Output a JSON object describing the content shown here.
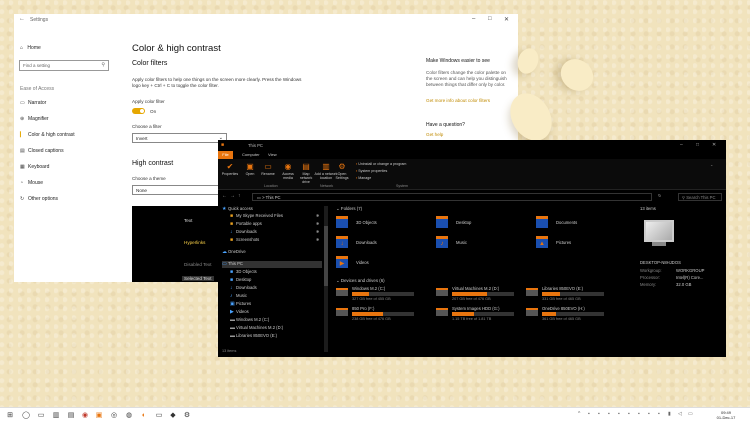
{
  "settings": {
    "window_title": "Settings",
    "nav": {
      "home": "Home",
      "search_placeholder": "Find a setting",
      "section": "Ease of Access",
      "items": [
        {
          "label": "Narrator",
          "icon": "narrator-icon"
        },
        {
          "label": "Magnifier",
          "icon": "magnifier-icon"
        },
        {
          "label": "Color & high contrast",
          "icon": "color-contrast-icon",
          "selected": true
        },
        {
          "label": "Closed captions",
          "icon": "captions-icon"
        },
        {
          "label": "Keyboard",
          "icon": "keyboard-icon"
        },
        {
          "label": "Mouse",
          "icon": "mouse-icon"
        },
        {
          "label": "Other options",
          "icon": "other-options-icon"
        }
      ]
    },
    "main": {
      "title": "Color & high contrast",
      "color_filters": {
        "heading": "Color filters",
        "description": "Apply color filters to help one things on the screen more clearly. Press the Windows logo key + Ctrl + C to toggle the color filter.",
        "toggle_label": "Apply color filter",
        "toggle_state": "On",
        "filter_label": "Choose a filter",
        "filter_value": "Invert"
      },
      "high_contrast": {
        "heading": "High contrast",
        "theme_label": "Choose a theme",
        "theme_value": "None",
        "preview": {
          "text": "Text",
          "hyperlinks": "Hyperlinks",
          "disabled_text": "Disabled Text",
          "selected_text": "Selected Text"
        }
      }
    },
    "side": {
      "heading": "Make Windows easier to see",
      "text": "Color filters change the color palette on the screen and can help you distinguish between things that differ only by color.",
      "link": "Get more info about color filters",
      "question": "Have a question?",
      "help_link": "Get help"
    }
  },
  "explorer": {
    "title": "This PC",
    "tabs": [
      "File",
      "Computer",
      "View"
    ],
    "ribbon": {
      "buttons": [
        "Properties",
        "Open",
        "Rename",
        "Access media",
        "Map network drive",
        "Add a network location",
        "Open Settings"
      ],
      "small_items": [
        "Uninstall or change a program",
        "System properties",
        "Manage"
      ],
      "groups": [
        "Location",
        "Network",
        "System"
      ]
    },
    "address": "This PC",
    "search_placeholder": "Search This PC",
    "tree": [
      {
        "label": "Quick access",
        "icon": "star-icon",
        "indent": 0
      },
      {
        "label": "My Skype Received Files",
        "icon": "folder-icon",
        "indent": 1,
        "pinned": true
      },
      {
        "label": "Portable apps",
        "icon": "folder-icon",
        "indent": 1,
        "pinned": true
      },
      {
        "label": "Downloads",
        "icon": "downloads-icon",
        "indent": 1,
        "pinned": true
      },
      {
        "label": "Screenshots",
        "icon": "folder-icon",
        "indent": 1,
        "pinned": true
      },
      {
        "label": "OneDrive",
        "icon": "cloud-icon",
        "indent": 0
      },
      {
        "label": "This PC",
        "icon": "pc-icon",
        "indent": 0,
        "selected": true
      },
      {
        "label": "3D Objects",
        "icon": "folder-icon",
        "indent": 1
      },
      {
        "label": "Desktop",
        "icon": "folder-icon",
        "indent": 1
      },
      {
        "label": "Downloads",
        "icon": "downloads-icon",
        "indent": 1
      },
      {
        "label": "Music",
        "icon": "music-icon",
        "indent": 1
      },
      {
        "label": "Pictures",
        "icon": "pictures-icon",
        "indent": 1
      },
      {
        "label": "Videos",
        "icon": "videos-icon",
        "indent": 1
      },
      {
        "label": "Windows M.2 (C:)",
        "icon": "drive-icon",
        "indent": 1
      },
      {
        "label": "Virtual Machines M.2 (D:)",
        "icon": "drive-icon",
        "indent": 1
      },
      {
        "label": "Libraries 850EVO (E:)",
        "icon": "drive-icon",
        "indent": 1
      }
    ],
    "folders_header": "Folders (7)",
    "folders": [
      {
        "name": "3D Objects",
        "icon": "folder-3d-icon"
      },
      {
        "name": "Desktop",
        "icon": "folder-desktop-icon"
      },
      {
        "name": "Documents",
        "icon": "folder-documents-icon"
      },
      {
        "name": "Downloads",
        "icon": "folder-downloads-icon"
      },
      {
        "name": "Music",
        "icon": "folder-music-icon"
      },
      {
        "name": "Pictures",
        "icon": "folder-pictures-icon"
      },
      {
        "name": "Videos",
        "icon": "folder-videos-icon"
      }
    ],
    "drives_header": "Devices and drives (6)",
    "drives": [
      {
        "name": "Windows M.2 (C:)",
        "free": "327 GB free of 455 GB",
        "used_pct": 28
      },
      {
        "name": "Virtual Machines M.2 (D:)",
        "free": "207 GB free of 476 GB",
        "used_pct": 57
      },
      {
        "name": "Libraries 850EVO (E:)",
        "free": "331 GB free of 465 GB",
        "used_pct": 29
      },
      {
        "name": "850 Pro (F:)",
        "free": "238 GB free of 476 GB",
        "used_pct": 50
      },
      {
        "name": "System Images HDD (G:)",
        "free": "1.15 TB free of 1.81 TB",
        "used_pct": 36
      },
      {
        "name": "OneDrive 850EVO (H:)",
        "free": "361 GB free of 465 GB",
        "used_pct": 22
      }
    ],
    "details": {
      "count": "13 items",
      "name": "DESKTOP-N8HJDOS",
      "rows": [
        {
          "k": "Workgroup:",
          "v": "WORKGROUP"
        },
        {
          "k": "Processor:",
          "v": "Intel(R) Core..."
        },
        {
          "k": "Memory:",
          "v": "32.0 GB"
        }
      ]
    },
    "status": "13 items"
  },
  "taskbar": {
    "clock_time": "09:49",
    "clock_date": "01-Dec-17"
  }
}
